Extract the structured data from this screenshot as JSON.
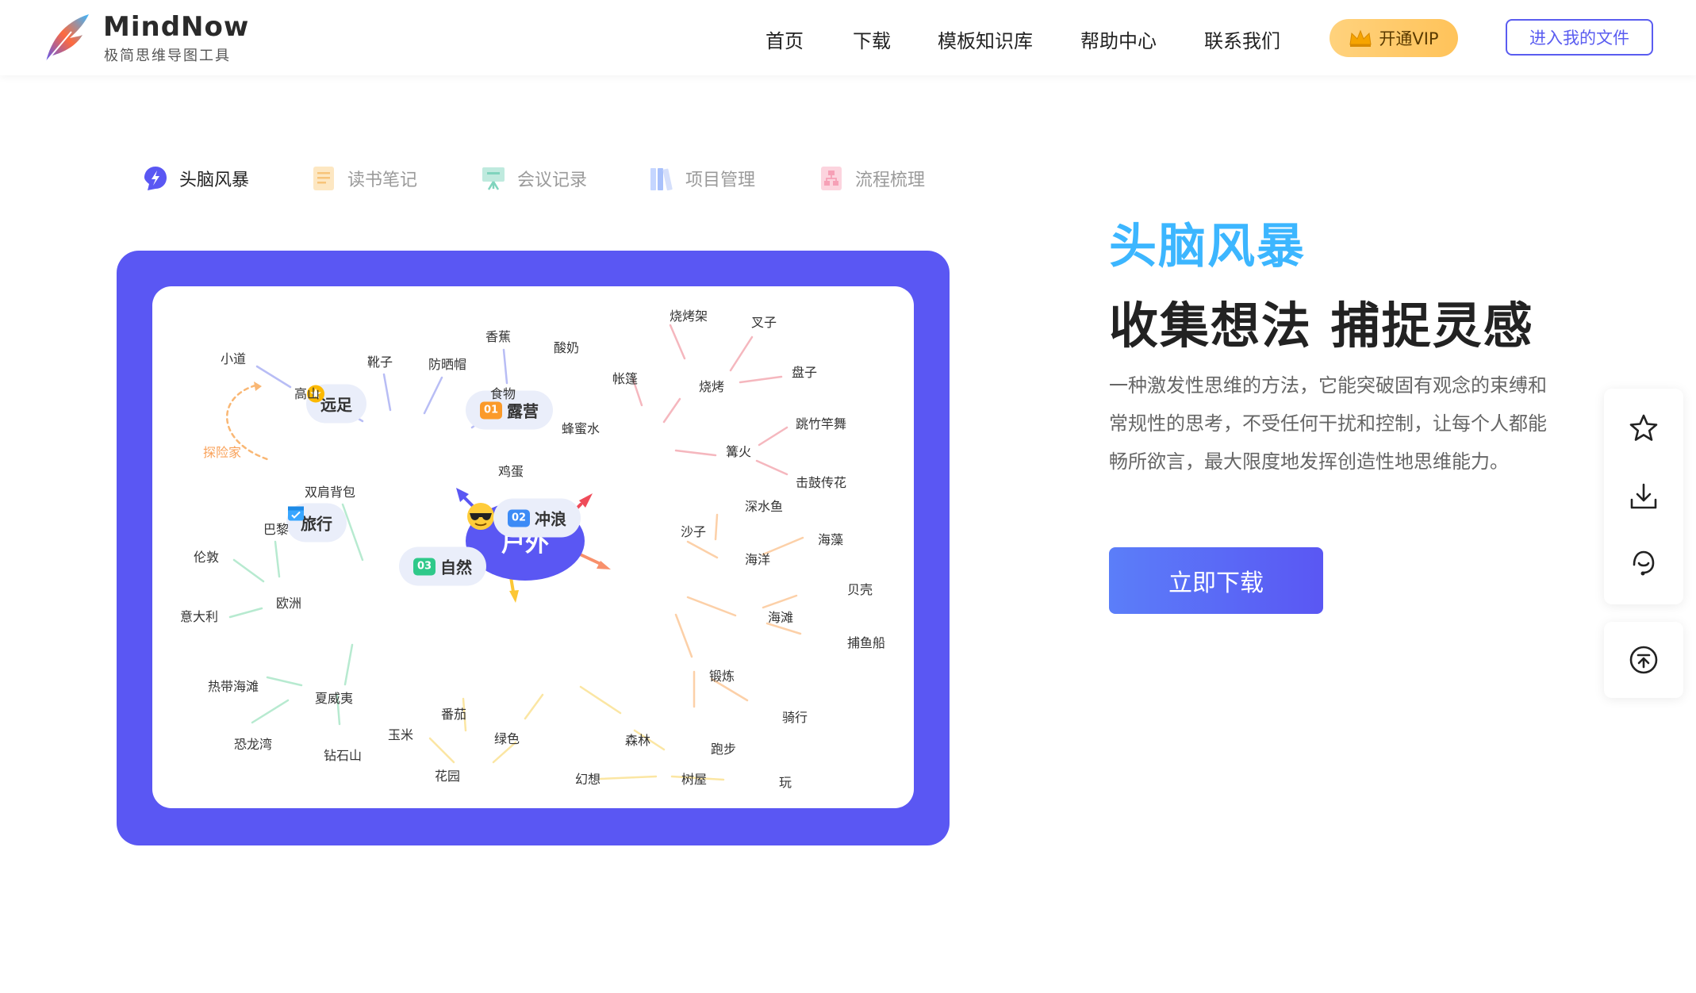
{
  "brand": {
    "name": "MindNow",
    "tagline": "极简思维导图工具"
  },
  "nav": {
    "items": [
      "首页",
      "下载",
      "模板知识库",
      "帮助中心",
      "联系我们"
    ],
    "vip_label": "开通VIP",
    "files_label": "进入我的文件"
  },
  "tabs": [
    {
      "label": "头脑风暴",
      "icon": "lightning-icon",
      "active": true
    },
    {
      "label": "读书笔记",
      "icon": "notebook-icon",
      "active": false
    },
    {
      "label": "会议记录",
      "icon": "presentation-icon",
      "active": false
    },
    {
      "label": "项目管理",
      "icon": "books-icon",
      "active": false
    },
    {
      "label": "流程梳理",
      "icon": "flow-icon",
      "active": false
    }
  ],
  "mindmap": {
    "center": "户外",
    "branches": {
      "yuanzu": "远足",
      "luying": "露营",
      "lvxing": "旅行",
      "chonglang": "冲浪",
      "ziran": "自然"
    },
    "badges": {
      "luying": "01",
      "chonglang": "02",
      "ziran": "03"
    },
    "nodes": {
      "xiaodao": "小道",
      "gaoshan": "高山",
      "xiezi": "靴子",
      "fangshaimao": "防晒帽",
      "xiangjiao": "香蕉",
      "shiwu": "食物",
      "suannai": "酸奶",
      "tanxianjia": "探险家",
      "shuangjianbeibao": "双肩背包",
      "jidan": "鸡蛋",
      "fengmishui": "蜂蜜水",
      "zhangpeng": "帐篷",
      "shaokaojia": "烧烤架",
      "chazi": "叉子",
      "shaokao": "烧烤",
      "panzi": "盘子",
      "tiaozhuganwu": "跳竹竿舞",
      "gouhuo": "篝火",
      "jigu": "击鼓传花",
      "shenshuiyu": "深水鱼",
      "shazi": "沙子",
      "haizao": "海藻",
      "haiyang": "海洋",
      "beike": "贝壳",
      "haitan": "海滩",
      "buyuchuan": "捕鱼船",
      "duanlian": "锻炼",
      "qixing": "骑行",
      "paobu": "跑步",
      "bali": "巴黎",
      "lundun": "伦敦",
      "ouzhou": "欧洲",
      "yidali": "意大利",
      "redaihaitan": "热带海滩",
      "xiaweiyi": "夏威夷",
      "konglongwan": "恐龙湾",
      "zuanshishan": "钻石山",
      "fanqie": "番茄",
      "yumi": "玉米",
      "lvse": "绿色",
      "huayuan": "花园",
      "senlin": "森林",
      "huanxiang": "幻想",
      "shuwu": "树屋",
      "wan": "玩"
    }
  },
  "hero": {
    "tag": "头脑风暴",
    "title": "收集想法 捕捉灵感",
    "description": "一种激发性思维的方法，它能突破固有观念的束缚和常规性的思考，不受任何干扰和控制，让每个人都能畅所欲言，最大限度地发挥创造性地思维能力。",
    "download_label": "立即下载"
  },
  "colors": {
    "accent": "#5a57f3",
    "hero_tag": "#3cb6ff",
    "vip": "#ffc35a"
  },
  "side_icons": [
    "star-icon",
    "download-icon",
    "support-icon",
    "back-to-top-icon"
  ]
}
